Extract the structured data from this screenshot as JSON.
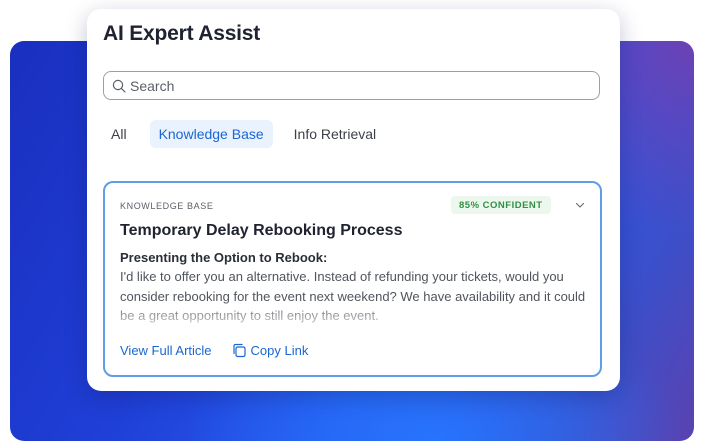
{
  "panel": {
    "title": "AI Expert Assist"
  },
  "search": {
    "placeholder": "Search",
    "value": "",
    "icon": "search-icon"
  },
  "tabs": [
    {
      "label": "All",
      "active": false
    },
    {
      "label": "Knowledge Base",
      "active": true
    },
    {
      "label": "Info Retrieval",
      "active": false
    }
  ],
  "result": {
    "source_label": "KNOWLEDGE BASE",
    "confidence": "85% CONFIDENT",
    "title": "Temporary Delay Rebooking Process",
    "subtitle": "Presenting the Option to Rebook:",
    "body": "I'd like to offer you an alternative. Instead of refunding your tickets, would you consider rebooking for the event next weekend? We have availability and it could be a great opportunity to still enjoy the event.",
    "view_label": "View Full Article",
    "copy_label": "Copy Link",
    "copy_icon": "copy-icon",
    "expand_icon": "chevron-down-icon"
  },
  "colors": {
    "accent": "#1a66d2",
    "card_border": "#5e9ee6",
    "confidence_text": "#2f8f43",
    "confidence_bg": "#ecf7ee",
    "backdrop_start": "#1a2fbf",
    "backdrop_end": "#5b42b0"
  }
}
